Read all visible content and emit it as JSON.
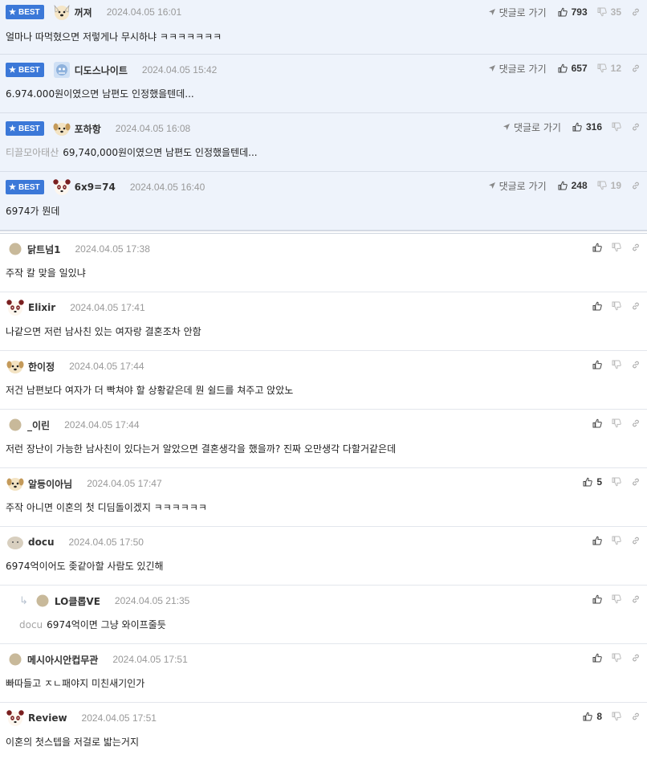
{
  "best_badge": "BEST",
  "reply_label": "댓글로 가기",
  "comments": [
    {
      "best": true,
      "nick": "꺼져",
      "date": "2024.04.05 16:01",
      "text": "얼마나 따먹혔으면 저렇게나 무시하냐 ㅋㅋㅋㅋㅋㅋㅋ",
      "ref": "",
      "up": "793",
      "down": "35",
      "avatar": "dog-face"
    },
    {
      "best": true,
      "nick": "디도스나이트",
      "date": "2024.04.05 15:42",
      "text": "6.974.000원이였으면 남편도 인정했을텐데...",
      "ref": "",
      "up": "657",
      "down": "12",
      "avatar": "robot"
    },
    {
      "best": true,
      "nick": "포하항",
      "date": "2024.04.05 16:08",
      "text": "69,740,000원이였으면 남편도 인정했을텐데...",
      "ref": "티끌모아태산",
      "up": "316",
      "down": "",
      "avatar": "puppy"
    },
    {
      "best": true,
      "nick": "6x9=74",
      "date": "2024.04.05 16:40",
      "text": "6974가 뭔데",
      "ref": "",
      "up": "248",
      "down": "19",
      "avatar": "panda"
    },
    {
      "best": false,
      "nick": "닭트넘1",
      "date": "2024.04.05 17:38",
      "text": "주작 칼 맞을 일있냐",
      "ref": "",
      "up": "",
      "down": "",
      "avatar": "dot"
    },
    {
      "best": false,
      "nick": "Elixir",
      "date": "2024.04.05 17:41",
      "text": "나같으면 저런 남사친 있는 여자랑 결혼조차 안함",
      "ref": "",
      "up": "",
      "down": "",
      "avatar": "panda"
    },
    {
      "best": false,
      "nick": "한이정",
      "date": "2024.04.05 17:44",
      "text": "저건 남편보다 여자가 더 빡쳐야 할 상황같은데 뭔 쉴드를 쳐주고 앉았노",
      "ref": "",
      "up": "",
      "down": "",
      "avatar": "puppy"
    },
    {
      "best": false,
      "nick": "_이린",
      "date": "2024.04.05 17:44",
      "text": "저런 장난이 가능한 남사친이 있다는거 알았으면 결혼생각을 했을까? 진짜 오만생각 다할거같은데",
      "ref": "",
      "up": "",
      "down": "",
      "avatar": "dot"
    },
    {
      "best": false,
      "nick": "알등이아님",
      "date": "2024.04.05 17:47",
      "text": "주작 아니면 이혼의 첫 디딤돌이겠지 ㅋㅋㅋㅋㅋㅋ",
      "ref": "",
      "up": "5",
      "down": "",
      "avatar": "puppy"
    },
    {
      "best": false,
      "nick": "docu",
      "date": "2024.04.05 17:50",
      "text": "6974억이어도 좆같아할 사람도 있긴해",
      "ref": "",
      "up": "",
      "down": "",
      "avatar": "blob"
    },
    {
      "best": false,
      "nested": true,
      "nick": "LO클롭VE",
      "date": "2024.04.05 21:35",
      "text": "6974억이면 그냥 와이프줄듯",
      "ref": "docu",
      "up": "",
      "down": "",
      "avatar": "dot"
    },
    {
      "best": false,
      "nick": "메시아시안컵무관",
      "date": "2024.04.05 17:51",
      "text": "빠따들고 ㅈㄴ패야지 미친새기인가",
      "ref": "",
      "up": "",
      "down": "",
      "avatar": "dot"
    },
    {
      "best": false,
      "nick": "Review",
      "date": "2024.04.05 17:51",
      "text": "이혼의 첫스텝을 저걸로 밟는거지",
      "ref": "",
      "up": "8",
      "down": "",
      "avatar": "panda"
    }
  ],
  "colors": {
    "best_badge": "#3b78d8",
    "best_bg": "#eef3fb"
  }
}
